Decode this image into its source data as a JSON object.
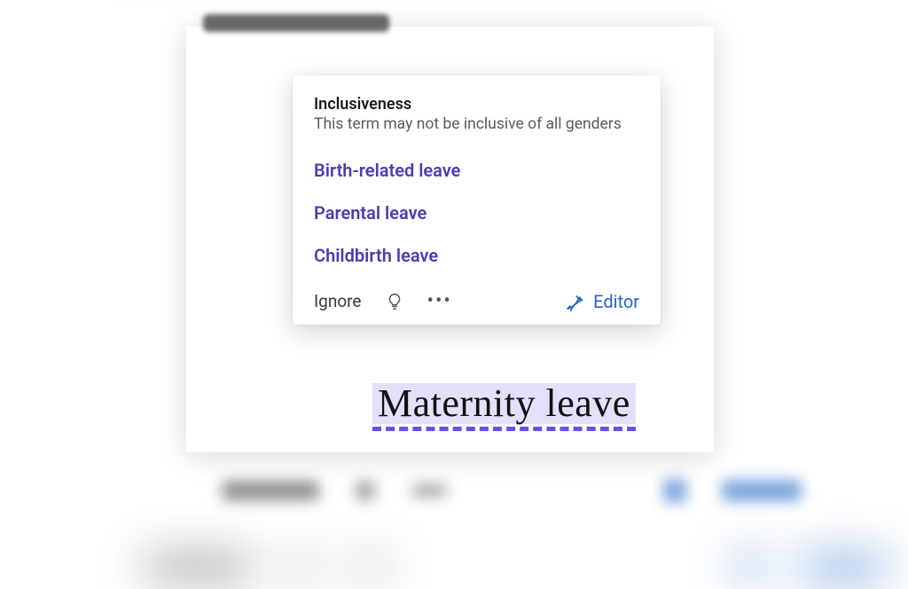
{
  "popover": {
    "title": "Inclusiveness",
    "description": "This term may not be inclusive of all genders",
    "suggestions": [
      "Birth-related leave",
      "Parental leave",
      "Childbirth leave"
    ],
    "ignore_label": "Ignore",
    "editor_label": "Editor"
  },
  "document": {
    "flagged_term": "Maternity leave"
  },
  "colors": {
    "suggestion": "#4a3db3",
    "editor_link": "#2166c9",
    "underline": "#6b4ee6",
    "highlight_bg": "#e6dffb"
  }
}
